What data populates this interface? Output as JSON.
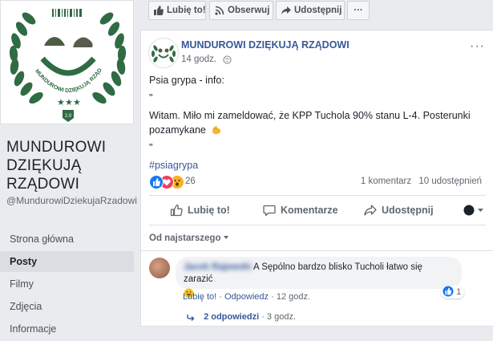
{
  "page": {
    "name": "MUNDUROWI DZIĘKUJĄ RZĄDOWI",
    "handle": "@MundurowiDziekujaRzadowi",
    "logo_ring_text": "MUNDUROWI DZIĘKUJĄ RZĄDOWI",
    "logo_badge_text": "2.0"
  },
  "nav": {
    "items": [
      "Strona główna",
      "Posty",
      "Filmy",
      "Zdjęcia",
      "Informacje"
    ],
    "active_index": 1
  },
  "toolbar": {
    "like_label": "Lubię to!",
    "follow_label": "Obserwuj",
    "share_label": "Udostępnij",
    "more_label": "···"
  },
  "post": {
    "author": "MUNDUROWI DZIĘKUJĄ RZĄDOWI",
    "time": "14 godz.",
    "line1": "Psia grypa - info:",
    "quote_open": "\"",
    "body": "Witam. Miło mi zameldować, że KPP Tuchola 90% stanu L-4. Posterunki pozamykane",
    "body_emoji": "muscle-emoji",
    "quote_close": "\"",
    "hashtag": "#psiagrypa",
    "reaction_count": "26",
    "comment_count": "1 komentarz",
    "share_count": "10 udostępnień",
    "more_label": "···"
  },
  "actions": {
    "like": "Lubię to!",
    "comment": "Komentarze",
    "share": "Udostępnij"
  },
  "comments": {
    "sort_label": "Od najstarszego",
    "items": [
      {
        "author": "Jacek Rajewski",
        "text": "A Sępólno bardzo blisko Tucholi łatwo się zarazić",
        "like_action": "Lubię to!",
        "reply_action": "Odpowiedz",
        "time": "12 godz.",
        "like_count": "1",
        "replies_label": "2 odpowiedzi",
        "replies_time": "3 godz."
      }
    ]
  },
  "colors": {
    "link": "#385898",
    "facebook_blue": "#4267b2",
    "like_blue": "#1877f2",
    "logo_green": "#2f6b43",
    "love_red": "#f33e58",
    "wow_yellow": "#f7b125"
  }
}
